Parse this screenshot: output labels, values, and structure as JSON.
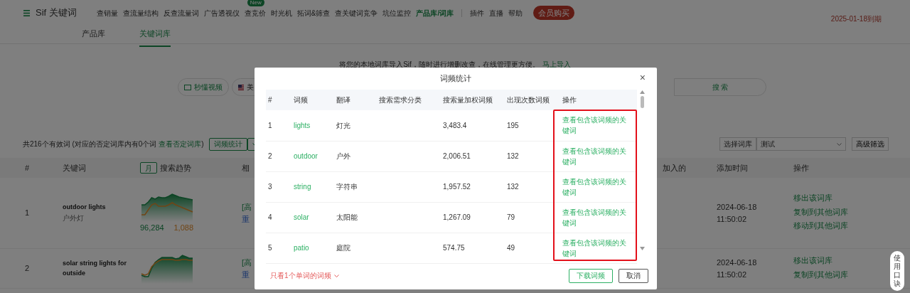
{
  "header": {
    "logo": "Sif 关键词",
    "nav": [
      {
        "label": "查销量",
        "selected": false
      },
      {
        "label": "查流量结构",
        "selected": false
      },
      {
        "label": "反查流量词",
        "selected": false
      },
      {
        "label": "广告透视仪",
        "selected": false
      },
      {
        "label": "查竞价",
        "selected": false,
        "badge": "New"
      },
      {
        "label": "时光机",
        "selected": false
      },
      {
        "label": "拓词&筛查",
        "selected": false
      },
      {
        "label": "查关键词竞争",
        "selected": false
      },
      {
        "label": "坑位监控",
        "selected": false
      },
      {
        "label": "产品库/词库",
        "selected": true
      },
      {
        "label": "插件",
        "selected": false
      },
      {
        "label": "直播",
        "selected": false
      },
      {
        "label": "帮助",
        "selected": false
      }
    ],
    "vip_button": "会员购买",
    "expiry": "2025-01-18到期"
  },
  "subtabs": [
    {
      "label": "产品库",
      "selected": false
    },
    {
      "label": "关键词库",
      "selected": true
    }
  ],
  "import_banner": {
    "text": "将您的本地词库导入Sif，随时进行增删改查，在线管理更方便。",
    "link": "马上导入"
  },
  "toolbar": {
    "video_button": "秒懂视频",
    "market": "美",
    "search_button": "搜 索"
  },
  "summary": {
    "text": "共216个有效词  (对应的否定词库内有0个词",
    "link": "查看否定词库",
    "tail": ")",
    "word_freq_button": "词频统计",
    "library_label": "选择词库",
    "library_value": "测试",
    "filter_button": "高级筛选"
  },
  "table": {
    "columns": [
      "#",
      "关键词",
      "搜索趋势",
      "相",
      "加入的",
      "添加时间",
      "操作"
    ],
    "trend_toggle": "月",
    "rows": [
      {
        "index": "1",
        "keyword": "outdoor lights",
        "translation": "户外灯",
        "volume": "96,284",
        "rank": "1,088",
        "tag": "[高",
        "link": "重",
        "added": "2024-06-18 11:50:02",
        "actions": [
          "移出该词库",
          "复制到其他词库",
          "移动到其他词库"
        ]
      },
      {
        "index": "2",
        "keyword": "solar string lights for outside",
        "volume": "",
        "rank": "",
        "tag": "[高",
        "link": "重",
        "added": "2024-06-18 11:50:02",
        "actions": [
          "移出该词库",
          "复制到其他词库"
        ]
      }
    ]
  },
  "side_tab": "使用口诀",
  "dialog": {
    "title": "词频统计",
    "close": "×",
    "columns": [
      "#",
      "词频",
      "翻译",
      "搜索需求分类",
      "搜索量加权词频",
      "出现次数词频",
      "操作"
    ],
    "rows": [
      {
        "index": "1",
        "word": "lights",
        "translation": "灯光",
        "weighted": "3,483.4",
        "count": "195",
        "action": "查看包含该词频的关键词"
      },
      {
        "index": "2",
        "word": "outdoor",
        "translation": "户外",
        "weighted": "2,006.51",
        "count": "132",
        "action": "查看包含该词频的关键词"
      },
      {
        "index": "3",
        "word": "string",
        "translation": "字符串",
        "weighted": "1,957.52",
        "count": "132",
        "action": "查看包含该词频的关键词"
      },
      {
        "index": "4",
        "word": "solar",
        "translation": "太阳能",
        "weighted": "1,267.09",
        "count": "79",
        "action": "查看包含该词频的关键词"
      },
      {
        "index": "5",
        "word": "patio",
        "translation": "庭院",
        "weighted": "574.75",
        "count": "49",
        "action": "查看包含该词频的关键词"
      }
    ],
    "filter": "只看1个单词的词频",
    "buttons": [
      {
        "label": "下载词频",
        "kind": "primary"
      },
      {
        "label": "取消",
        "kind": "secondary"
      }
    ]
  }
}
